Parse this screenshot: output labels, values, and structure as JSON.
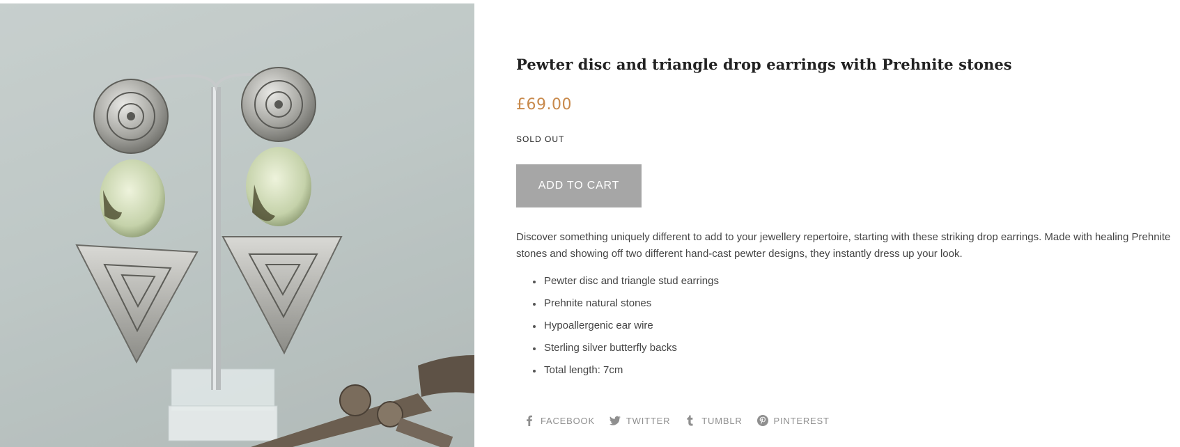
{
  "product": {
    "title": "Pewter disc and triangle drop earrings with Prehnite stones",
    "price": "£69.00",
    "stock_status": "SOLD OUT",
    "add_to_cart_label": "ADD TO CART",
    "description": "Discover something uniquely different to add to your jewellery repertoire, starting with these striking drop earrings. Made with healing Prehnite stones and showing off two different hand-cast pewter designs, they instantly dress up your look.",
    "features": [
      "Pewter disc and triangle stud earrings",
      "Prehnite natural stones",
      "Hypoallergenic ear wire",
      "Sterling silver butterfly backs",
      "Total length: 7cm"
    ]
  },
  "share": [
    {
      "label": "FACEBOOK",
      "icon": "facebook-icon"
    },
    {
      "label": "TWITTER",
      "icon": "twitter-icon"
    },
    {
      "label": "TUMBLR",
      "icon": "tumblr-icon"
    },
    {
      "label": "PINTEREST",
      "icon": "pinterest-icon"
    }
  ],
  "colors": {
    "price": "#c8894b",
    "button_bg": "#a6a6a6",
    "share_text": "#8f8f8f"
  }
}
